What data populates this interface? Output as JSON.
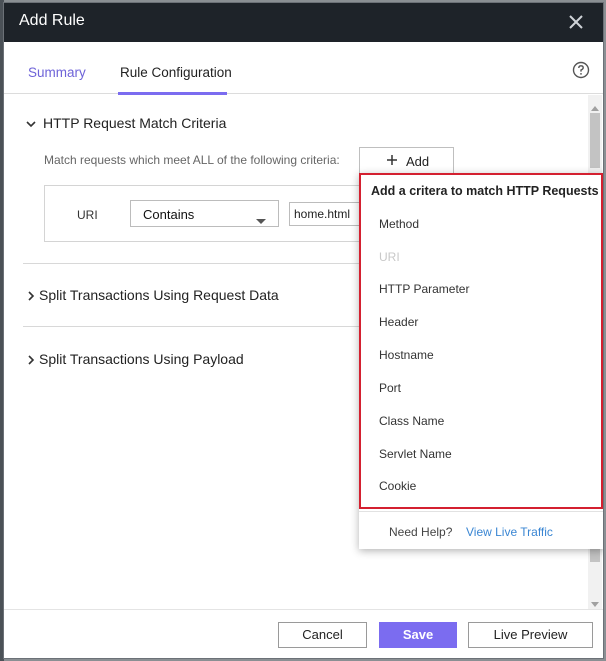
{
  "dialog": {
    "title": "Add Rule"
  },
  "tabs": [
    {
      "label": "Summary"
    },
    {
      "label": "Rule Configuration"
    }
  ],
  "sections": {
    "http_match": {
      "title": "HTTP Request Match Criteria",
      "hint": "Match requests which meet ALL of the following criteria:",
      "add_label": "Add",
      "criterion": {
        "label": "URI",
        "operator": "Contains",
        "value": "home.html"
      }
    },
    "split_request": {
      "title": "Split Transactions Using Request Data"
    },
    "split_payload": {
      "title": "Split Transactions Using Payload"
    }
  },
  "popup": {
    "title": "Add a critera to match HTTP Requests",
    "items": [
      {
        "label": "Method",
        "disabled": false
      },
      {
        "label": "URI",
        "disabled": true
      },
      {
        "label": "HTTP Parameter",
        "disabled": false
      },
      {
        "label": "Header",
        "disabled": false
      },
      {
        "label": "Hostname",
        "disabled": false
      },
      {
        "label": "Port",
        "disabled": false
      },
      {
        "label": "Class Name",
        "disabled": false
      },
      {
        "label": "Servlet Name",
        "disabled": false
      },
      {
        "label": "Cookie",
        "disabled": false
      }
    ],
    "need_help": "Need Help?",
    "help_link": "View Live Traffic"
  },
  "footer": {
    "cancel": "Cancel",
    "save": "Save",
    "preview": "Live Preview"
  },
  "colors": {
    "accent": "#7b6cf0",
    "highlight": "#d42030",
    "link": "#3a86d3",
    "titlebar": "#1e2329"
  },
  "icons": {
    "close": "close-icon",
    "help": "help-icon",
    "plus": "plus-icon",
    "chevron": "chevron-icon",
    "caret": "caret-down-icon"
  }
}
